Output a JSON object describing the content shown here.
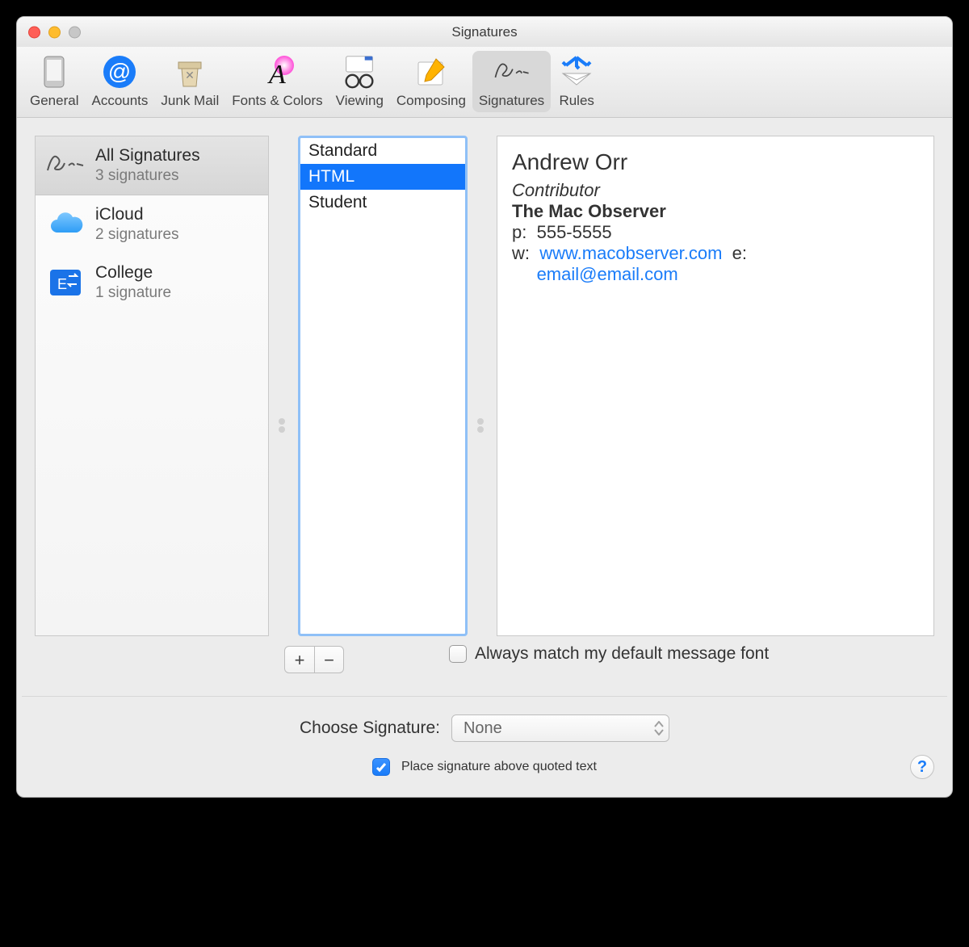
{
  "window": {
    "title": "Signatures"
  },
  "toolbar": {
    "items": [
      {
        "id": "general",
        "label": "General"
      },
      {
        "id": "accounts",
        "label": "Accounts"
      },
      {
        "id": "junk-mail",
        "label": "Junk Mail"
      },
      {
        "id": "fonts-colors",
        "label": "Fonts & Colors"
      },
      {
        "id": "viewing",
        "label": "Viewing"
      },
      {
        "id": "composing",
        "label": "Composing"
      },
      {
        "id": "signatures",
        "label": "Signatures",
        "active": true
      },
      {
        "id": "rules",
        "label": "Rules"
      }
    ]
  },
  "accounts": {
    "rows": [
      {
        "id": "all",
        "title": "All Signatures",
        "subtitle": "3 signatures",
        "icon": "sig-icon",
        "selected": true
      },
      {
        "id": "icloud",
        "title": "iCloud",
        "subtitle": "2 signatures",
        "icon": "cloud-icon"
      },
      {
        "id": "college",
        "title": "College",
        "subtitle": "1 signature",
        "icon": "exchange-icon"
      }
    ]
  },
  "signatures": {
    "items": [
      "Standard",
      "HTML",
      "Student"
    ],
    "selected_index": 1
  },
  "preview": {
    "name": "Andrew Orr",
    "role": "Contributor",
    "org": "The Mac Observer",
    "phone_label": "p:",
    "phone": "555-5555",
    "web_label": "w:",
    "web": "www.macobserver.com",
    "email_label": "e:",
    "email": "email@email.com"
  },
  "controls": {
    "add_label": "+",
    "remove_label": "−",
    "match_font_label": "Always match my default message font",
    "match_font_checked": false,
    "choose_signature_label": "Choose Signature:",
    "choose_signature_value": "None",
    "place_above_label": "Place signature above quoted text",
    "place_above_checked": true,
    "help_label": "?"
  }
}
